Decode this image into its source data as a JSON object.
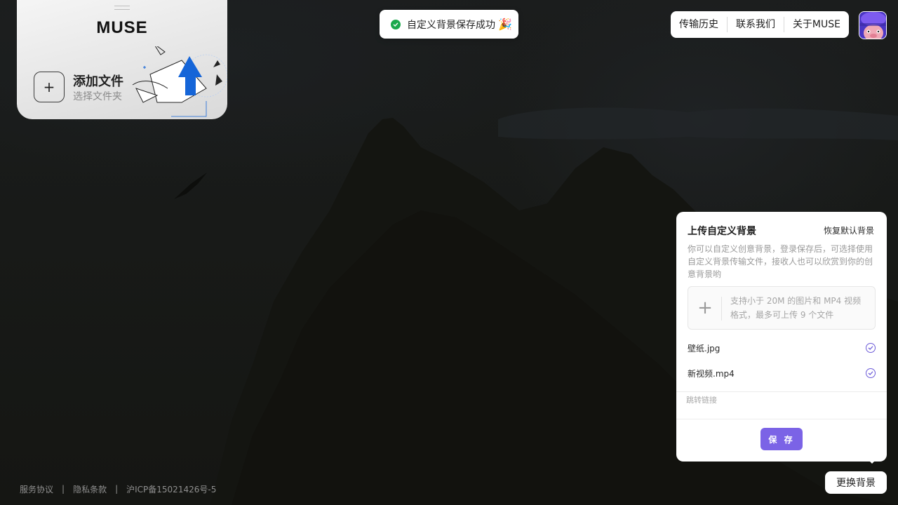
{
  "upload_card": {
    "brand": "MUSE",
    "add_title": "添加文件",
    "add_subtitle": "选择文件夹",
    "add_icon": "plus-icon"
  },
  "toast": {
    "text": "自定义背景保存成功",
    "emoji": "🎉",
    "status_color": "#1ba94c"
  },
  "topnav": {
    "items": [
      {
        "label": "传输历史"
      },
      {
        "label": "联系我们"
      },
      {
        "label": "关于MUSE"
      }
    ]
  },
  "bg_panel": {
    "title": "上传自定义背景",
    "reset_label": "恢复默认背景",
    "description": "你可以自定义创意背景，登录保存后，可选择使用自定义背景传输文件，接收人也可以欣赏到你的创意背景哟",
    "dropzone_text": "支持小于 20M 的图片和 MP4 视频格式，最多可上传 9 个文件",
    "files": [
      {
        "name": "壁纸.jpg",
        "status": "check-circle-icon"
      },
      {
        "name": "新视频.mp4",
        "status": "check-circle-icon"
      }
    ],
    "link_placeholder": "跳转链接",
    "link_value": "",
    "save_label": "保 存",
    "accent_color": "#7b63e6"
  },
  "change_bg_label": "更换背景",
  "footer": {
    "links": [
      {
        "label": "服务协议"
      },
      {
        "label": "隐私条款"
      },
      {
        "label": "沪ICP备15021426号-5"
      }
    ],
    "separator": "|"
  }
}
